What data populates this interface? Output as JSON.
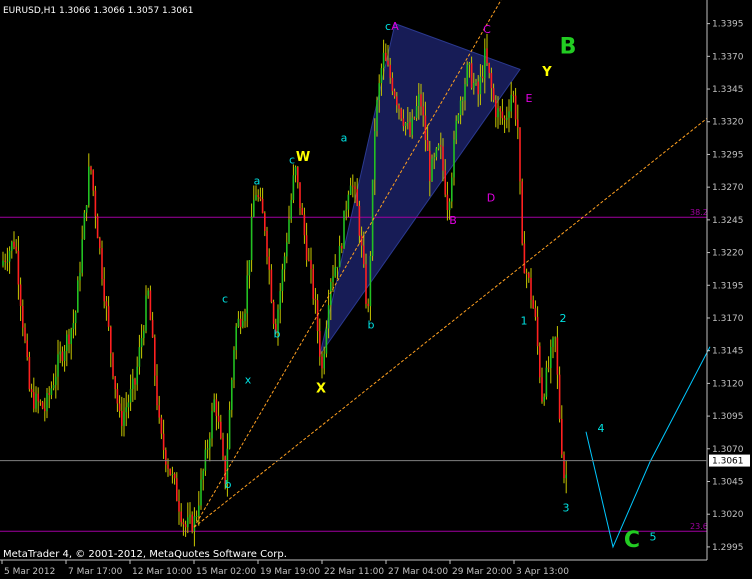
{
  "header": {
    "symbol_info": "EURUSD,H1  1.3066 1.3066 1.3057 1.3061"
  },
  "footer": {
    "copyright": "MetaTrader 4, © 2001-2012, MetaQuotes Software Corp."
  },
  "colors": {
    "background": "#000000",
    "axis": "#c0c0c0",
    "bull": "#22c022",
    "bear": "#ff2020",
    "wick": "#c8c800",
    "fibo": "#a000a0",
    "trend": "#ffa020",
    "label_cyan": "#00e0e0",
    "label_magenta": "#e000e0",
    "label_yellow": "#ffff00",
    "label_green": "#22cc22",
    "projection": "#00c8ff",
    "triangle": "#1a2060"
  },
  "chart_data": {
    "type": "candlestick",
    "symbol": "EURUSD",
    "timeframe": "H1",
    "ohlc_current": {
      "open": 1.3066,
      "high": 1.3066,
      "low": 1.3057,
      "close": 1.3061
    },
    "current_price_label": "1.3061",
    "current_price": 1.3061,
    "ylim": [
      1.2985,
      1.341
    ],
    "y_ticks": [
      "1.3395",
      "1.3370",
      "1.3345",
      "1.3320",
      "1.3295",
      "1.3270",
      "1.3245",
      "1.3220",
      "1.3195",
      "1.3170",
      "1.3145",
      "1.3120",
      "1.3095",
      "1.3070",
      "1.3045",
      "1.3020",
      "1.2995"
    ],
    "x_ticks": [
      "5 Mar 2012",
      "7 Mar 17:00",
      "12 Mar 10:00",
      "15 Mar 02:00",
      "19 Mar 19:00",
      "22 Mar 11:00",
      "27 Mar 04:00",
      "29 Mar 20:00",
      "3 Apr 13:00"
    ],
    "fibo_levels": [
      {
        "label": "38.2",
        "price": 1.3247
      },
      {
        "label": "23.6",
        "price": 1.3007
      }
    ],
    "price_path": [
      [
        0,
        1.321
      ],
      [
        15,
        1.323
      ],
      [
        30,
        1.311
      ],
      [
        45,
        1.31
      ],
      [
        60,
        1.314
      ],
      [
        75,
        1.317
      ],
      [
        90,
        1.329
      ],
      [
        100,
        1.322
      ],
      [
        110,
        1.315
      ],
      [
        120,
        1.309
      ],
      [
        135,
        1.312
      ],
      [
        148,
        1.319
      ],
      [
        160,
        1.308
      ],
      [
        175,
        1.304
      ],
      [
        185,
        1.301
      ],
      [
        195,
        1.3015
      ],
      [
        205,
        1.306
      ],
      [
        215,
        1.311
      ],
      [
        225,
        1.3045
      ],
      [
        235,
        1.316
      ],
      [
        245,
        1.318
      ],
      [
        255,
        1.327
      ],
      [
        265,
        1.324
      ],
      [
        275,
        1.316
      ],
      [
        285,
        1.322
      ],
      [
        295,
        1.3285
      ],
      [
        305,
        1.323
      ],
      [
        315,
        1.318
      ],
      [
        322,
        1.313
      ],
      [
        330,
        1.32
      ],
      [
        340,
        1.322
      ],
      [
        350,
        1.328
      ],
      [
        358,
        1.325
      ],
      [
        368,
        1.317
      ],
      [
        375,
        1.332
      ],
      [
        383,
        1.337
      ],
      [
        392,
        1.335
      ],
      [
        400,
        1.333
      ],
      [
        410,
        1.331
      ],
      [
        420,
        1.334
      ],
      [
        430,
        1.328
      ],
      [
        440,
        1.33
      ],
      [
        448,
        1.3255
      ],
      [
        458,
        1.333
      ],
      [
        468,
        1.336
      ],
      [
        478,
        1.334
      ],
      [
        485,
        1.337
      ],
      [
        495,
        1.333
      ],
      [
        505,
        1.332
      ],
      [
        512,
        1.3345
      ],
      [
        518,
        1.3315
      ],
      [
        522,
        1.322
      ],
      [
        528,
        1.32
      ],
      [
        535,
        1.317
      ],
      [
        542,
        1.311
      ],
      [
        548,
        1.313
      ],
      [
        555,
        1.3155
      ],
      [
        560,
        1.309
      ],
      [
        565,
        1.304
      ],
      [
        568,
        1.3065
      ]
    ],
    "trendlines": [
      {
        "from": [
          "15 Mar 02:00",
          1.301
        ],
        "to": [
          "3 Apr 13:00",
          1.343
        ]
      },
      {
        "from": [
          "15 Mar 02:00",
          1.301
        ],
        "to": [
          "3 Apr 13:00",
          1.3205
        ]
      }
    ],
    "wave_labels": [
      {
        "text": "c",
        "price": 1.339,
        "color": "cyan",
        "size": "small",
        "x": 388
      },
      {
        "text": "A",
        "price": 1.339,
        "color": "magenta",
        "size": "small",
        "x": 395
      },
      {
        "text": "C",
        "price": 1.3388,
        "color": "magenta",
        "size": "small",
        "x": 487
      },
      {
        "text": "B",
        "price": 1.3372,
        "color": "green",
        "size": "big",
        "x": 568
      },
      {
        "text": "Y",
        "price": 1.3355,
        "color": "yellow",
        "size": "mid",
        "x": 547
      },
      {
        "text": "E",
        "price": 1.3335,
        "color": "magenta",
        "size": "small",
        "x": 529
      },
      {
        "text": "a",
        "price": 1.3305,
        "color": "cyan",
        "size": "small",
        "x": 344
      },
      {
        "text": "c",
        "price": 1.3288,
        "color": "cyan",
        "size": "small",
        "x": 292
      },
      {
        "text": "W",
        "price": 1.329,
        "color": "yellow",
        "size": "mid",
        "x": 303
      },
      {
        "text": "a",
        "price": 1.3272,
        "color": "cyan",
        "size": "small",
        "x": 257
      },
      {
        "text": "D",
        "price": 1.3259,
        "color": "magenta",
        "size": "small",
        "x": 491
      },
      {
        "text": "B",
        "price": 1.3242,
        "color": "magenta",
        "size": "small",
        "x": 453
      },
      {
        "text": "c",
        "price": 1.3182,
        "color": "cyan",
        "size": "small",
        "x": 225
      },
      {
        "text": "b",
        "price": 1.3155,
        "color": "cyan",
        "size": "small",
        "x": 277
      },
      {
        "text": "b",
        "price": 1.3162,
        "color": "cyan",
        "size": "small",
        "x": 371
      },
      {
        "text": "x",
        "price": 1.312,
        "color": "cyan",
        "size": "small",
        "x": 248
      },
      {
        "text": "X",
        "price": 1.3113,
        "color": "yellow",
        "size": "mid",
        "x": 321
      },
      {
        "text": "b",
        "price": 1.304,
        "color": "cyan",
        "size": "small",
        "x": 228
      },
      {
        "text": "1",
        "price": 1.3165,
        "color": "cyan",
        "size": "small",
        "x": 524
      },
      {
        "text": "2",
        "price": 1.3167,
        "color": "cyan",
        "size": "small",
        "x": 563
      },
      {
        "text": "4",
        "price": 1.3083,
        "color": "cyan",
        "size": "small",
        "x": 601
      },
      {
        "text": "3",
        "price": 1.3022,
        "color": "cyan",
        "size": "small",
        "x": 566
      },
      {
        "text": "C",
        "price": 1.2995,
        "color": "green",
        "size": "big",
        "x": 632
      },
      {
        "text": "5",
        "price": 1.3,
        "color": "cyan",
        "size": "small",
        "x": 653
      }
    ],
    "projection_path": [
      [
        586,
        1.3083
      ],
      [
        613,
        1.2995
      ],
      [
        650,
        1.306
      ],
      [
        710,
        1.3148
      ]
    ],
    "triangle": [
      [
        395,
        1.3395
      ],
      [
        520,
        1.336
      ],
      [
        320,
        1.3142
      ]
    ]
  }
}
